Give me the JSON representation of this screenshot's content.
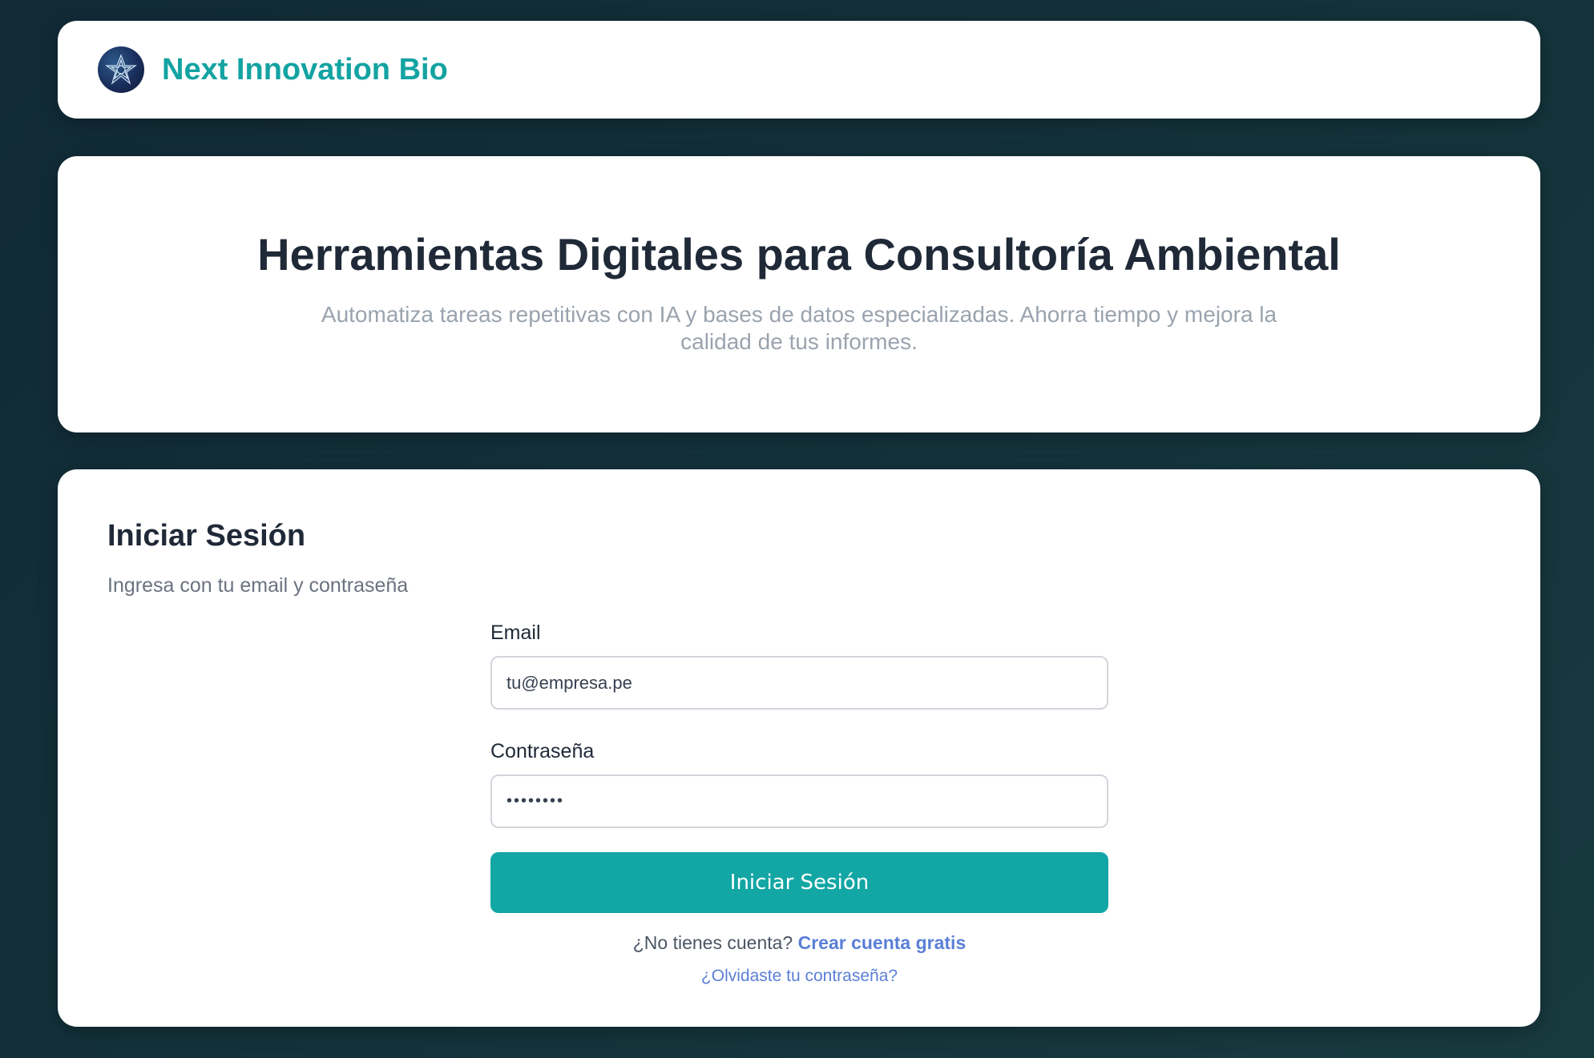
{
  "header": {
    "brand": "Next Innovation Bio",
    "logo_icon": "star-mandala-icon"
  },
  "hero": {
    "title": "Herramientas Digitales para Consultoría Ambiental",
    "subtitle": "Automatiza tareas repetitivas con IA y bases de datos especializadas. Ahorra tiempo y mejora la calidad de tus informes."
  },
  "login": {
    "title": "Iniciar Sesión",
    "subtitle": "Ingresa con tu email y contraseña",
    "email_label": "Email",
    "email_value": "tu@empresa.pe",
    "password_label": "Contraseña",
    "password_value": "••••••••",
    "submit_label": "Iniciar Sesión",
    "signup_prompt": "¿No tienes cuenta?",
    "signup_link": "Crear cuenta gratis",
    "forgot_link": "¿Olvidaste tu contraseña?"
  },
  "colors": {
    "accent": "#12a6a4",
    "link": "#5a7fd6",
    "background": "#112a36"
  }
}
